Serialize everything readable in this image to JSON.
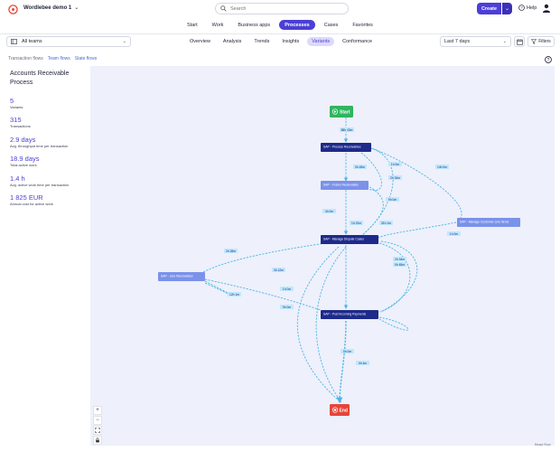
{
  "header": {
    "workspace": "Wordlebee demo 1",
    "search_placeholder": "Search",
    "create_label": "Create",
    "help_label": "Help"
  },
  "main_nav": [
    "Start",
    "Work",
    "Business apps",
    "Processes",
    "Cases",
    "Favorites"
  ],
  "main_nav_active": "Processes",
  "filters": {
    "team": "All teams",
    "date_range": "Last 7 days",
    "filters_label": "Filters"
  },
  "sub_nav": [
    "Overview",
    "Analysis",
    "Trends",
    "Insights",
    "Variants",
    "Conformance"
  ],
  "sub_nav_active": "Variants",
  "flow_tabs": [
    "Transaction flows",
    "Team flows",
    "State flows"
  ],
  "panel": {
    "title": "Accounts Receivable Process",
    "stats": [
      {
        "value": "5",
        "label": "Variants"
      },
      {
        "value": "315",
        "label": "Transactions"
      },
      {
        "value": "2.9 days",
        "label": "Avg. throughput time per transaction"
      },
      {
        "value": "18.9 days",
        "label": "Total active work"
      },
      {
        "value": "1.4 h",
        "label": "Avg. active work time per transaction"
      },
      {
        "value": "1 825 EUR",
        "label": "Annual cost for active work"
      }
    ]
  },
  "flow": {
    "start_label": "Start",
    "end_label": "End",
    "nodes": [
      {
        "id": "n1",
        "label": "SAP - Process Receivables",
        "style": "dark"
      },
      {
        "id": "n2",
        "label": "SAP - Future Receivables",
        "style": "light"
      },
      {
        "id": "n3",
        "label": "SAP - Manage Dispute Cases",
        "style": "dark"
      },
      {
        "id": "n4",
        "label": "SAP - Manage Customer Line Items",
        "style": "light"
      },
      {
        "id": "n5",
        "label": "SAP - Line Receivables",
        "style": "light"
      },
      {
        "id": "n6",
        "label": "SAP - Post Incoming Payments",
        "style": "dark"
      }
    ],
    "edge_labels": [
      "88h 43m",
      "0h 45m",
      "1h 0m",
      "14h 0m",
      "2h 34m",
      "9h 0m",
      "4h 0m",
      "1h 22m",
      "31h 1m",
      "1h 0m",
      "2h 28m",
      "2h 34m",
      "0h 45m",
      "3h 12m",
      "1h 0m",
      "12h 1m",
      "0h 0m",
      "0h 4m",
      "9h 0m"
    ]
  },
  "colors": {
    "accent": "#4b3fd6",
    "start": "#2fb55f",
    "end": "#e8443a",
    "node_dark": "#1e2a8a",
    "node_light": "#7b92ea",
    "edge": "#4ab8e6",
    "canvas_bg": "#eef0fb"
  },
  "attribution": "React Flow",
  "icons": [
    "logo-icon",
    "search-icon",
    "help-icon",
    "user-icon",
    "team-icon",
    "calendar-icon",
    "filter-icon",
    "question-icon",
    "play-icon",
    "stop-icon",
    "zoom-in-icon",
    "zoom-out-icon",
    "fit-view-icon",
    "lock-icon"
  ]
}
